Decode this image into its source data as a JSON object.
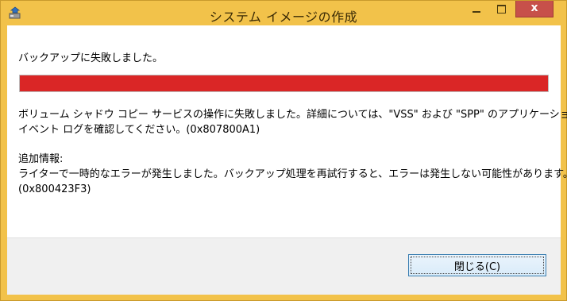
{
  "window": {
    "title": "システム イメージの作成",
    "app_icon": "system-image-icon",
    "title_bar_color": "#f2c24a",
    "close_button_color": "#c7504a",
    "close_glyph": "x"
  },
  "dialog": {
    "heading": "バックアップに失敗しました。",
    "progress": {
      "fraction": 1.0,
      "color": "#da2626",
      "state": "error"
    },
    "message_line1": "ボリューム シャドウ コピー サービスの操作に失敗しました。詳細については、\"VSS\" および \"SPP\" のアプリケーション",
    "message_line2": "イベント ログを確認してください。(0x807800A1)",
    "additional_info_title": "追加情報:",
    "additional_info_line1": "ライターで一時的なエラーが発生しました。バックアップ処理を再試行すると、エラーは発生しない可能性があります。",
    "additional_info_line2": "(0x800423F3)"
  },
  "buttons": {
    "close_label": "閉じる(C)"
  }
}
